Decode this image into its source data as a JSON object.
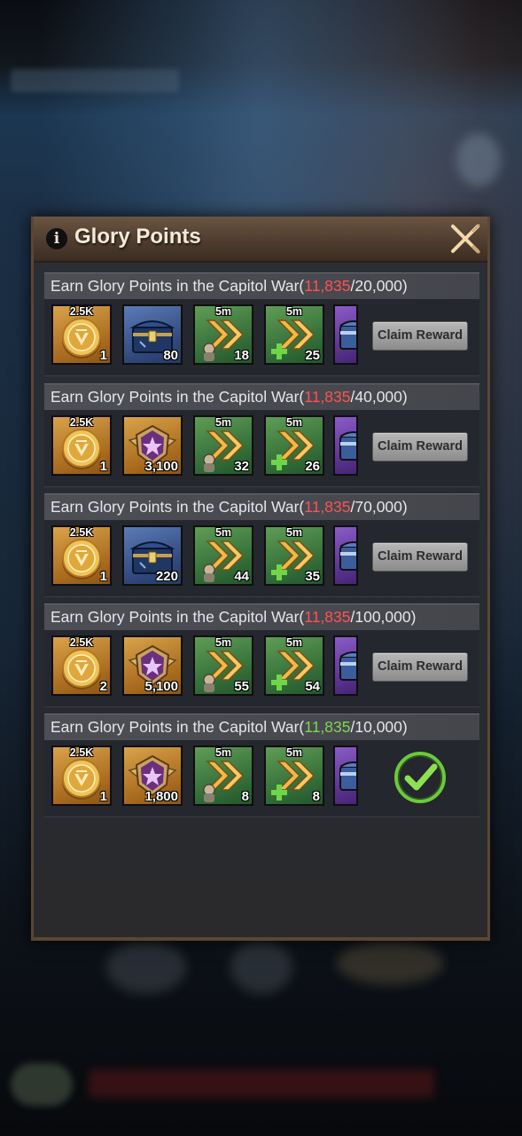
{
  "dialog": {
    "title": "Glory Points",
    "info_icon": "info-icon",
    "close_icon": "close-icon"
  },
  "rows": [
    {
      "label": "Earn Glory Points in the Capitol War(",
      "current": "11,835",
      "target": "/20,000)",
      "current_color": "red",
      "items": [
        {
          "icon": "gold-coin-icon",
          "top": "2.5K",
          "qty": "1",
          "bg": "gold"
        },
        {
          "icon": "blue-chest-icon",
          "top": "",
          "qty": "80",
          "bg": "blue"
        },
        {
          "icon": "speedup-icon",
          "top": "5m",
          "qty": "18",
          "bg": "green"
        },
        {
          "icon": "heal-speedup-icon",
          "top": "5m",
          "qty": "25",
          "bg": "green"
        },
        {
          "icon": "purple-chest-icon",
          "top": "",
          "qty": "",
          "bg": "purple"
        }
      ],
      "action": {
        "type": "button",
        "label": "Claim Reward"
      }
    },
    {
      "label": "Earn Glory Points in the Capitol War(",
      "current": "11,835",
      "target": "/40,000)",
      "current_color": "red",
      "items": [
        {
          "icon": "gold-coin-icon",
          "top": "2.5K",
          "qty": "1",
          "bg": "gold"
        },
        {
          "icon": "star-badge-icon",
          "top": "",
          "qty": "3,100",
          "bg": "gold"
        },
        {
          "icon": "speedup-icon",
          "top": "5m",
          "qty": "32",
          "bg": "green"
        },
        {
          "icon": "heal-speedup-icon",
          "top": "5m",
          "qty": "26",
          "bg": "green"
        },
        {
          "icon": "purple-chest-icon",
          "top": "",
          "qty": "",
          "bg": "purple"
        }
      ],
      "action": {
        "type": "button",
        "label": "Claim Reward"
      }
    },
    {
      "label": "Earn Glory Points in the Capitol War(",
      "current": "11,835",
      "target": "/70,000)",
      "current_color": "red",
      "items": [
        {
          "icon": "gold-coin-icon",
          "top": "2.5K",
          "qty": "1",
          "bg": "gold"
        },
        {
          "icon": "blue-chest-icon",
          "top": "",
          "qty": "220",
          "bg": "blue"
        },
        {
          "icon": "speedup-icon",
          "top": "5m",
          "qty": "44",
          "bg": "green"
        },
        {
          "icon": "heal-speedup-icon",
          "top": "5m",
          "qty": "35",
          "bg": "green"
        },
        {
          "icon": "purple-chest-icon",
          "top": "",
          "qty": "",
          "bg": "purple"
        }
      ],
      "action": {
        "type": "button",
        "label": "Claim Reward"
      }
    },
    {
      "label": "Earn Glory Points in the Capitol War(",
      "current": "11,835",
      "target": "/100,000)",
      "current_color": "red",
      "items": [
        {
          "icon": "gold-coin-icon",
          "top": "2.5K",
          "qty": "2",
          "bg": "gold"
        },
        {
          "icon": "star-badge-icon",
          "top": "",
          "qty": "5,100",
          "bg": "gold"
        },
        {
          "icon": "speedup-icon",
          "top": "5m",
          "qty": "55",
          "bg": "green"
        },
        {
          "icon": "heal-speedup-icon",
          "top": "5m",
          "qty": "54",
          "bg": "green"
        },
        {
          "icon": "purple-chest-icon",
          "top": "",
          "qty": "",
          "bg": "purple"
        }
      ],
      "action": {
        "type": "button",
        "label": "Claim Reward"
      }
    },
    {
      "label": "Earn Glory Points in the Capitol War(",
      "current": "11,835",
      "target": "/10,000)",
      "current_color": "green",
      "items": [
        {
          "icon": "gold-coin-icon",
          "top": "2.5K",
          "qty": "1",
          "bg": "gold"
        },
        {
          "icon": "star-badge-icon",
          "top": "",
          "qty": "1,800",
          "bg": "gold"
        },
        {
          "icon": "speedup-icon",
          "top": "5m",
          "qty": "8",
          "bg": "green"
        },
        {
          "icon": "heal-speedup-icon",
          "top": "5m",
          "qty": "8",
          "bg": "green"
        },
        {
          "icon": "purple-chest-icon",
          "top": "",
          "qty": "",
          "bg": "purple"
        }
      ],
      "action": {
        "type": "claimed",
        "icon": "checkmark-icon"
      }
    }
  ],
  "colors": {
    "progress_incomplete": "#ff5252",
    "progress_complete": "#7fd84e",
    "header_brown": "#5b4634"
  }
}
